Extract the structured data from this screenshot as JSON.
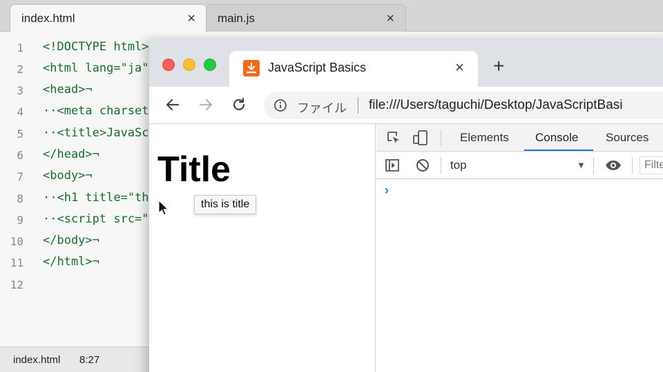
{
  "editor": {
    "tabs": [
      {
        "label": "index.html",
        "active": true
      },
      {
        "label": "main.js",
        "active": false
      }
    ],
    "close_glyph": "×",
    "line_numbers": [
      "1",
      "2",
      "3",
      "4",
      "5",
      "6",
      "7",
      "8",
      "9",
      "10",
      "11",
      "12"
    ],
    "lines": [
      "<!DOCTYPE html>",
      "<html lang=\"ja\"",
      "<head>¬",
      "··<meta charset",
      "··<title>JavaSc",
      "</head>¬",
      "<body>¬",
      "··<h1 title=\"th",
      "··<script src=\"",
      "</body>¬",
      "</html>¬",
      ""
    ],
    "status": {
      "file": "index.html",
      "position": "8:27"
    }
  },
  "browser": {
    "tab_title": "JavaScript Basics",
    "tab_close": "×",
    "new_tab": "+",
    "omnibox": {
      "scheme_label": "ファイル",
      "url": "file:///Users/taguchi/Desktop/JavaScriptBasi"
    },
    "page": {
      "heading": "Title",
      "tooltip": "this is title"
    },
    "devtools": {
      "tabs": [
        "Elements",
        "Console",
        "Sources"
      ],
      "active_tab": "Console",
      "context": "top",
      "filter_placeholder": "Filter",
      "prompt": "›"
    },
    "colors": {
      "traffic_red": "#fe5f57",
      "traffic_yellow": "#febc2e",
      "traffic_green": "#28c840",
      "accent": "#1a73e8",
      "favicon": "#f06a1d"
    }
  },
  "icons": [
    "back-arrow-icon",
    "forward-arrow-icon",
    "reload-icon",
    "info-icon",
    "inspect-element-icon",
    "device-toggle-icon",
    "sidebar-toggle-icon",
    "clear-console-icon",
    "eye-icon",
    "mouse-cursor-icon",
    "download-favicon-icon"
  ]
}
